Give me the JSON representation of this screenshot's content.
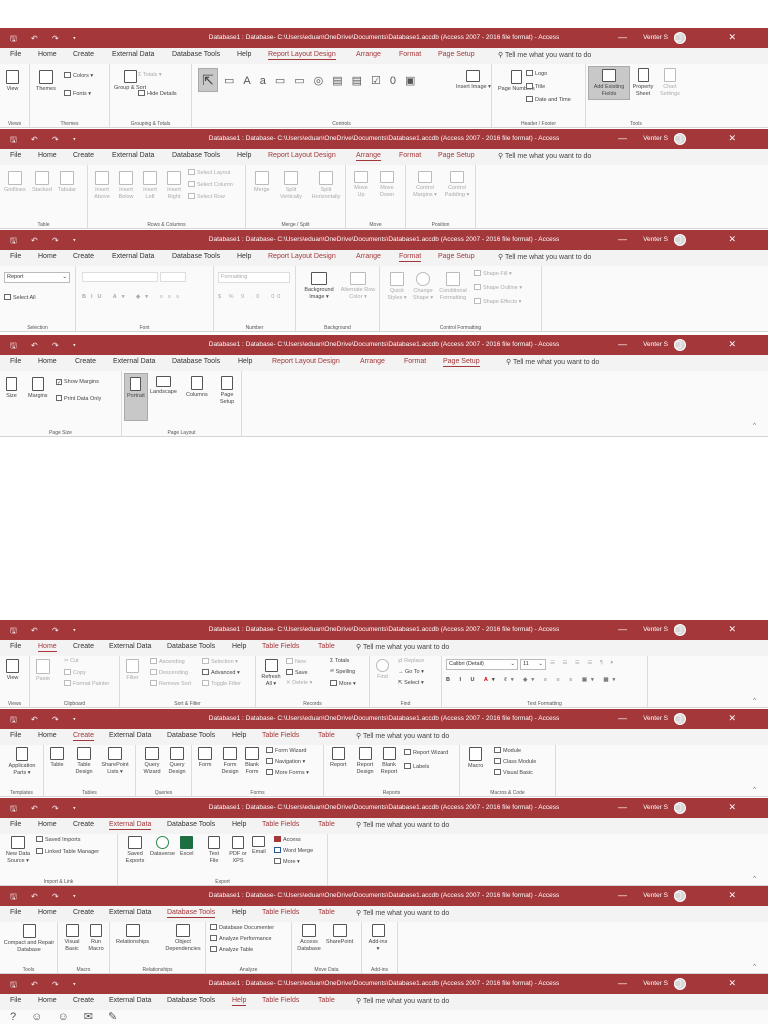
{
  "window": {
    "title_full": "Database1 : Database- C:\\Users\\eduan\\OneDrive\\Documents\\Database1.accdb (Access 2007 - 2016 file format) - Access",
    "user": "Venter S",
    "quick_access": "🖫 ↶ ↷ ▾",
    "window_controls": "— ▢ ✕"
  },
  "tabs": {
    "file": "File",
    "home": "Home",
    "create": "Create",
    "external_data": "External Data",
    "database_tools": "Database Tools",
    "help": "Help",
    "report_layout_design": "Report Layout Design",
    "arrange": "Arrange",
    "format": "Format",
    "page_setup": "Page Setup",
    "table_fields": "Table Fields",
    "table": "Table",
    "tell_me": "⚲  Tell me what you want to do"
  },
  "s1": {
    "view": "View",
    "themes": "Themes",
    "colors": "Colors ▾",
    "fonts": "Fonts ▾",
    "group_sort": "Group & Sort",
    "totals": "Σ Totals ▾",
    "hide_details": "Hide Details",
    "insert_image": "Insert Image ▾",
    "page_numbers": "Page Numbers",
    "logo": "Logo",
    "title": "Title",
    "date_time": "Date and Time",
    "add_fields": "Add Existing Fields",
    "property_sheet": "Property Sheet",
    "chart_settings": "Chart Settings",
    "g_views": "Views",
    "g_themes": "Themes",
    "g_grouping": "Grouping & Totals",
    "g_controls": "Controls",
    "g_header": "Header / Footer",
    "g_tools": "Tools"
  },
  "s2": {
    "gridlines": "Gridlines",
    "stacked": "Stacked",
    "tabular": "Tabular",
    "insert_above": "Insert Above",
    "insert_below": "Insert Below",
    "insert_left": "Insert Left",
    "insert_right": "Insert Right",
    "select_layout": "Select Layout",
    "select_column": "Select Column",
    "select_row": "Select Row",
    "merge": "Merge",
    "split_v": "Split Vertically",
    "split_h": "Split Horizontally",
    "move_up": "Move Up",
    "move_down": "Move Down",
    "control_margins": "Control Margins ▾",
    "control_padding": "Control Padding ▾",
    "g_table": "Table",
    "g_rows": "Rows & Columns",
    "g_merge": "Merge / Split",
    "g_move": "Move",
    "g_position": "Position"
  },
  "s3": {
    "report": "Report",
    "select_all": "Select All",
    "formatting": "Formatting",
    "bg_image": "Background Image ▾",
    "alt_row": "Alternate Row Color ▾",
    "quick_styles": "Quick Styles ▾",
    "change_shape": "Change Shape ▾",
    "cond_format": "Conditional Formatting",
    "shape_fill": "Shape Fill ▾",
    "shape_outline": "Shape Outline ▾",
    "shape_effects": "Shape Effects ▾",
    "g_selection": "Selection",
    "g_font": "Font",
    "g_number": "Number",
    "g_background": "Background",
    "g_control": "Control Formatting"
  },
  "s4": {
    "size": "Size",
    "margins": "Margins",
    "show_margins": "Show Margins",
    "print_data_only": "Print Data Only",
    "portrait": "Portrait",
    "landscape": "Landscape",
    "columns": "Columns",
    "page_setup": "Page Setup",
    "g_page_size": "Page Size",
    "g_page_layout": "Page Layout"
  },
  "s5": {
    "view": "View",
    "paste": "Paste",
    "cut": "Cut",
    "copy": "Copy",
    "format_painter": "Format Painter",
    "filter": "Filter",
    "ascending": "Ascending",
    "descending": "Descending",
    "remove_sort": "Remove Sort",
    "selection": "Selection ▾",
    "advanced": "Advanced ▾",
    "toggle_filter": "Toggle Filter",
    "refresh": "Refresh All ▾",
    "new": "New",
    "save": "Save",
    "delete": "Delete ▾",
    "totals": "Totals",
    "spelling": "Spelling",
    "more": "More ▾",
    "find": "Find",
    "replace": "Replace",
    "goto": "Go To ▾",
    "select": "Select ▾",
    "font": "Calibri (Detail)",
    "font_size": "11",
    "g_views": "Views",
    "g_clipboard": "Clipboard",
    "g_sort": "Sort & Filter",
    "g_records": "Records",
    "g_find": "Find",
    "g_text": "Text Formatting"
  },
  "s6": {
    "app_parts": "Application Parts ▾",
    "table": "Table",
    "table_design": "Table Design",
    "sharepoint_lists": "SharePoint Lists ▾",
    "query_wizard": "Query Wizard",
    "query_design": "Query Design",
    "form": "Form",
    "form_design": "Form Design",
    "blank_form": "Blank Form",
    "form_wizard": "Form Wizard",
    "navigation": "Navigation ▾",
    "more_forms": "More Forms ▾",
    "report": "Report",
    "report_design": "Report Design",
    "blank_report": "Blank Report",
    "report_wizard": "Report Wizard",
    "labels": "Labels",
    "macro": "Macro",
    "module": "Module",
    "class_module": "Class Module",
    "visual_basic": "Visual Basic",
    "g_templates": "Templates",
    "g_tables": "Tables",
    "g_queries": "Queries",
    "g_forms": "Forms",
    "g_reports": "Reports",
    "g_macros": "Macros & Code"
  },
  "s7": {
    "new_data_source": "New Data Source ▾",
    "saved_imports": "Saved Imports",
    "linked_table_manager": "Linked Table Manager",
    "saved_exports": "Saved Exports",
    "dataverse": "Dataverse",
    "excel": "Excel",
    "text_file": "Text File",
    "pdf_xps": "PDF or XPS",
    "email": "Email",
    "access": "Access",
    "word_merge": "Word Merge",
    "more": "More ▾",
    "g_import": "Import & Link",
    "g_export": "Export"
  },
  "s8": {
    "compact": "Compact and Repair Database",
    "visual_basic": "Visual Basic",
    "run_macro": "Run Macro",
    "relationships": "Relationships",
    "object_dependencies": "Object Dependencies",
    "database_documenter": "Database Documenter",
    "analyze_performance": "Analyze Performance",
    "analyze_table": "Analyze Table",
    "access_database": "Access Database",
    "sharepoint": "SharePoint",
    "add_ins": "Add-ins ▾",
    "g_tools": "Tools",
    "g_macro": "Macro",
    "g_relationships": "Relationships",
    "g_analyze": "Analyze",
    "g_move": "Move Data",
    "g_addins": "Add-ins"
  },
  "s9": {
    "help_icons": "?  ☺  ☺  ✉  ✎"
  }
}
